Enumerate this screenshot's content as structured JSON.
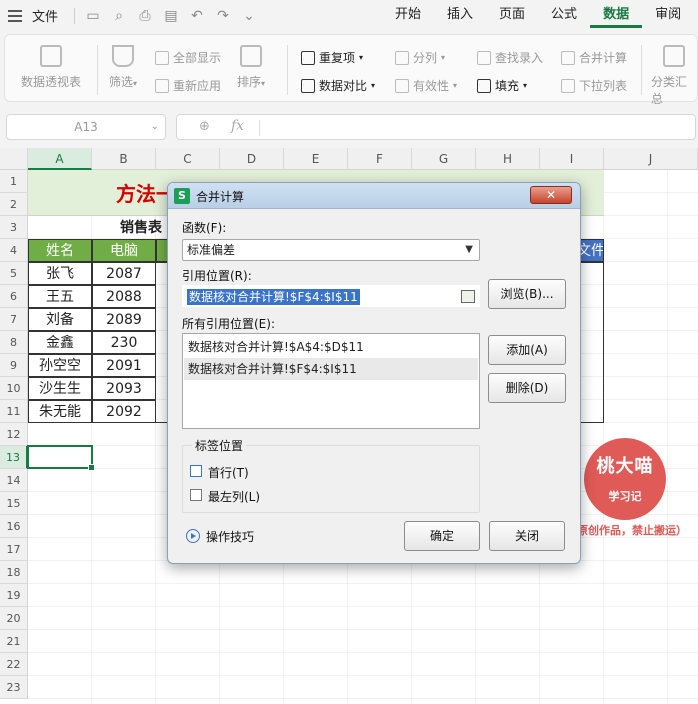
{
  "menubar": {
    "file_label": "文件",
    "tabs": [
      "开始",
      "插入",
      "页面",
      "公式",
      "数据",
      "审阅"
    ],
    "active_tab": "数据"
  },
  "ribbon": {
    "pivot": "数据透视表",
    "filter": "筛选",
    "show_all": "全部显示",
    "reapply": "重新应用",
    "sort": "排序",
    "duplicates": "重复项",
    "compare": "数据对比",
    "split": "分列",
    "validity": "有效性",
    "fill": "填充",
    "lookup": "查找录入",
    "consolidate": "合并计算",
    "dropdown": "下拉列表",
    "subtotal": "分类汇总"
  },
  "formula_bar": {
    "cell_ref": "A13",
    "fx": "fx",
    "content": ""
  },
  "sheet": {
    "columns": [
      "A",
      "B",
      "C",
      "D",
      "E",
      "F",
      "G",
      "H",
      "I",
      "J"
    ],
    "rows": [
      "1",
      "2",
      "3",
      "4",
      "5",
      "6",
      "7",
      "8",
      "9",
      "10",
      "11",
      "12",
      "13",
      "14",
      "15",
      "16",
      "17",
      "18",
      "19",
      "20",
      "21",
      "22",
      "23"
    ],
    "banner_title": "方法一",
    "subtitle": "销售表",
    "header": [
      "姓名",
      "电脑"
    ],
    "header_right": "文件",
    "data": [
      [
        "张飞",
        "2087"
      ],
      [
        "王五",
        "2088"
      ],
      [
        "刘备",
        "2089"
      ],
      [
        "金鑫",
        "230"
      ],
      [
        "孙空空",
        "2091"
      ],
      [
        "沙生生",
        "2093"
      ],
      [
        "朱无能",
        "2092"
      ]
    ]
  },
  "watermark": {
    "name": "桃大喵",
    "sub": "学习记",
    "note": "（原创作品，禁止搬运）"
  },
  "dialog": {
    "title": "合并计算",
    "function_label": "函数(F):",
    "function_value": "标准偏差",
    "ref_label": "引用位置(R):",
    "ref_value": "数据核对合并计算!$F$4:$I$11",
    "browse": "浏览(B)...",
    "all_refs_label": "所有引用位置(E):",
    "all_refs": [
      "数据核对合并计算!$A$4:$D$11",
      "数据核对合并计算!$F$4:$I$11"
    ],
    "add": "添加(A)",
    "delete": "删除(D)",
    "label_group": "标签位置",
    "first_row": "首行(T)",
    "left_col": "最左列(L)",
    "tips": "操作技巧",
    "ok": "确定",
    "close": "关闭",
    "close_glyph": "✕"
  }
}
